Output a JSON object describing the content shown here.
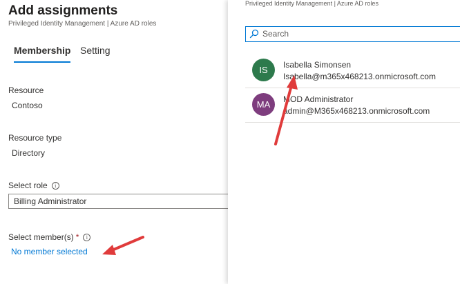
{
  "header": {
    "title": "Add assignments",
    "subtitle": "Privileged Identity Management | Azure AD roles"
  },
  "tabs": [
    {
      "label": "Membership",
      "active": true
    },
    {
      "label": "Setting",
      "active": false
    }
  ],
  "fields": {
    "resource": {
      "label": "Resource",
      "value": "Contoso"
    },
    "resource_type": {
      "label": "Resource type",
      "value": "Directory"
    },
    "role": {
      "label": "Select role",
      "value": "Billing Administrator"
    },
    "members": {
      "label": "Select member(s)",
      "required_mark": "*",
      "link": "No member selected"
    }
  },
  "flyout": {
    "subtitle": "Privileged Identity Management | Azure AD roles",
    "search": {
      "placeholder": "Search",
      "value": ""
    },
    "users": [
      {
        "initials": "IS",
        "name": "Isabella Simonsen",
        "email": "Isabella@m365x468213.onmicrosoft.com",
        "color": "#2d7a4c"
      },
      {
        "initials": "MA",
        "name": "MOD Administrator",
        "email": "admin@M365x468213.onmicrosoft.com",
        "color": "#7e3d7e"
      }
    ]
  },
  "icons": {
    "info": "info-icon",
    "search": "search-icon"
  },
  "colors": {
    "accent": "#0078d4",
    "annotation": "#e03b3b",
    "required": "#a4262c"
  }
}
